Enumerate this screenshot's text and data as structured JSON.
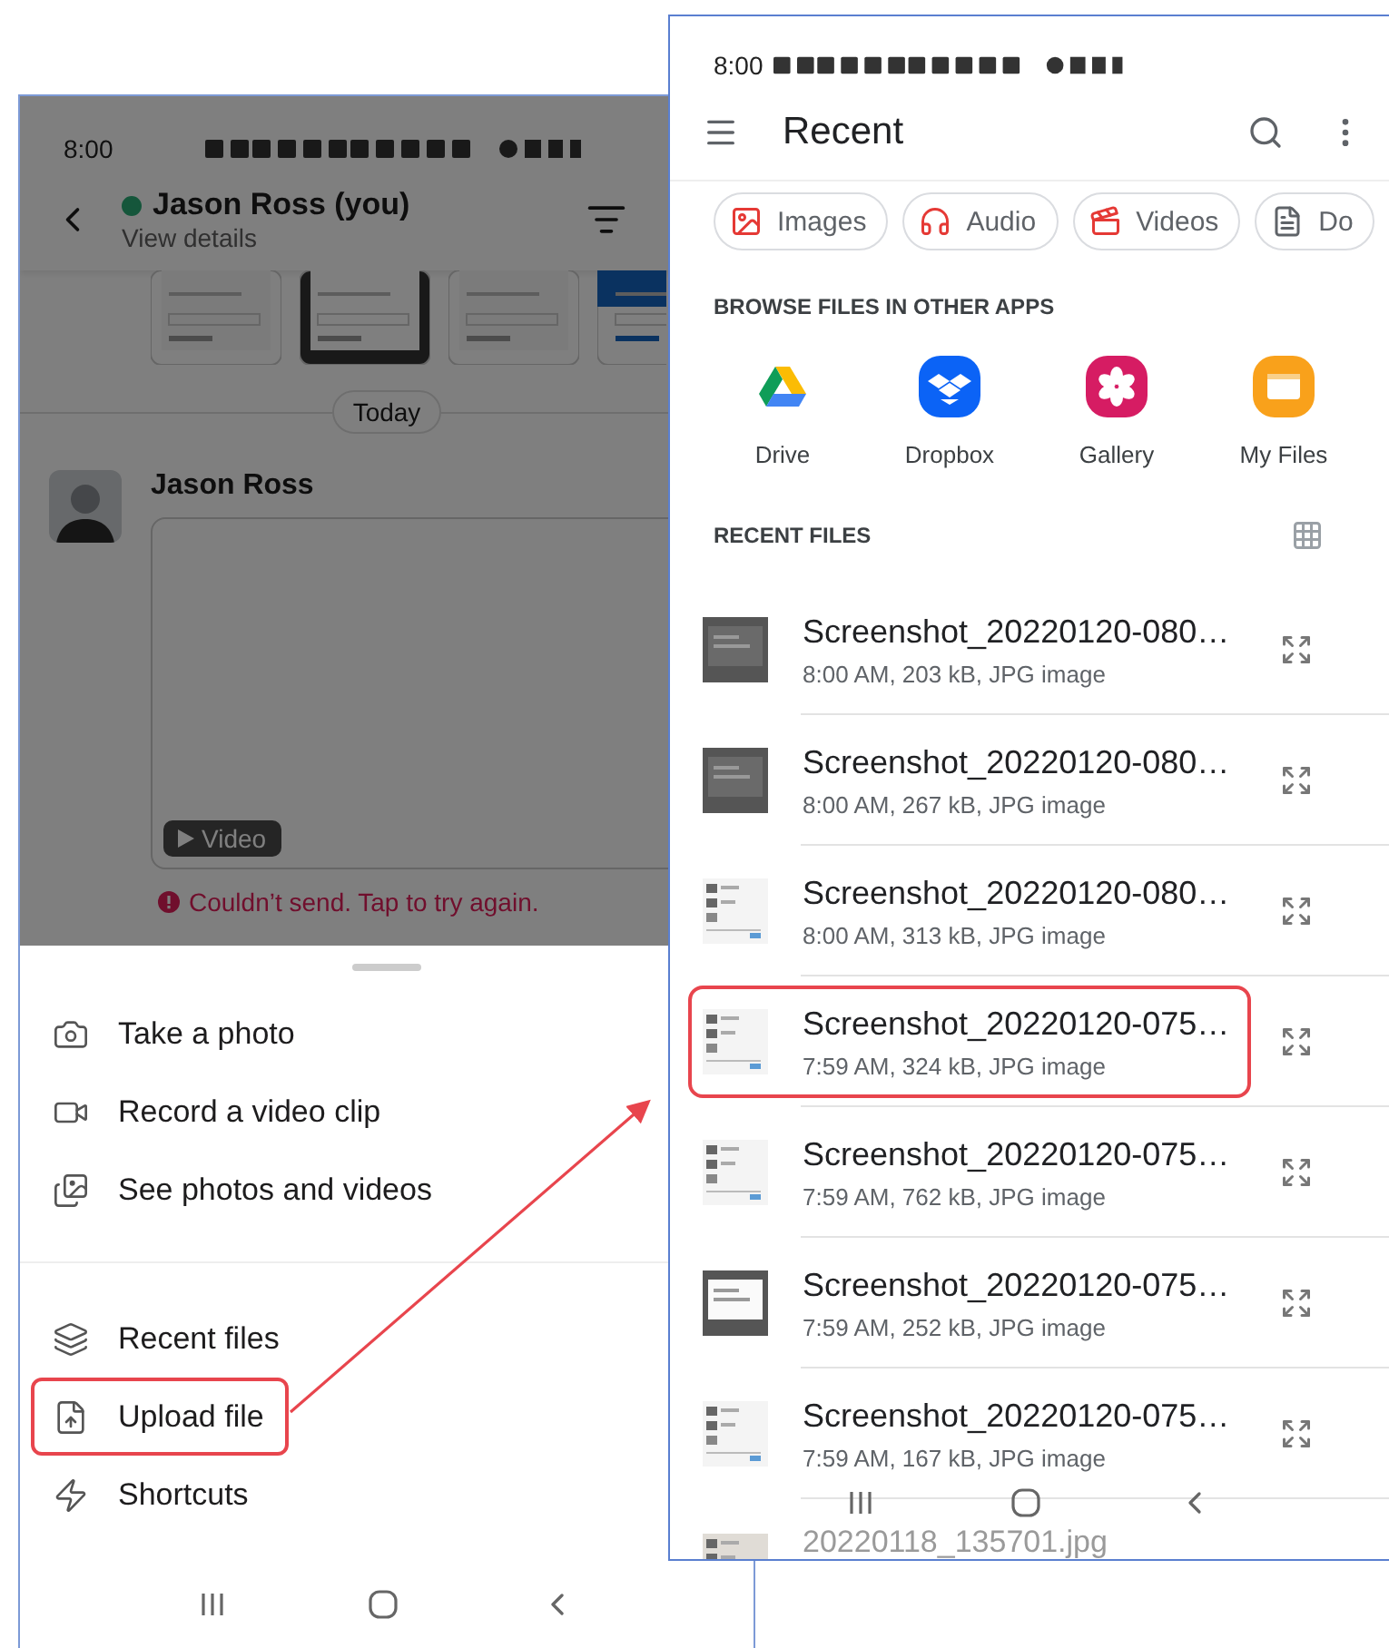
{
  "left_phone": {
    "status_time": "8:00",
    "dimmed": true,
    "chat": {
      "title": "Jason Ross (you)",
      "online": true,
      "subtitle": "View details",
      "day_divider": "Today",
      "message": {
        "sender": "Jason Ross",
        "attachment_label": "Video",
        "error": "Couldn’t send. Tap to try again."
      }
    },
    "sheet": {
      "sections": [
        [
          {
            "kind": "camera",
            "label": "Take a photo",
            "highlighted": false
          },
          {
            "kind": "video",
            "label": "Record a video clip",
            "highlighted": false
          },
          {
            "kind": "gallery",
            "label": "See photos and videos",
            "highlighted": false
          }
        ],
        [
          {
            "kind": "layers",
            "label": "Recent files",
            "highlighted": false
          },
          {
            "kind": "upload",
            "label": "Upload file",
            "highlighted": true
          },
          {
            "kind": "bolt",
            "label": "Shortcuts",
            "highlighted": false
          }
        ]
      ]
    }
  },
  "right_phone": {
    "status_time": "8:00",
    "title": "Recent",
    "chips": [
      {
        "kind": "images",
        "label": "Images"
      },
      {
        "kind": "audio",
        "label": "Audio"
      },
      {
        "kind": "videos",
        "label": "Videos"
      },
      {
        "kind": "docs",
        "label": "Do"
      }
    ],
    "apps_heading": "BROWSE FILES IN OTHER APPS",
    "apps": [
      {
        "kind": "drive",
        "label": "Drive"
      },
      {
        "kind": "dropbox",
        "label": "Dropbox"
      },
      {
        "kind": "gallery",
        "label": "Gallery"
      },
      {
        "kind": "myfiles",
        "label": "My Files"
      }
    ],
    "recent_heading": "RECENT FILES",
    "files": [
      {
        "name": "Screenshot_20220120-080…",
        "details": "8:00 AM, 203 kB, JPG image",
        "highlighted": false
      },
      {
        "name": "Screenshot_20220120-080…",
        "details": "8:00 AM, 267 kB, JPG image",
        "highlighted": false
      },
      {
        "name": "Screenshot_20220120-080…",
        "details": "8:00 AM, 313 kB, JPG image",
        "highlighted": false
      },
      {
        "name": "Screenshot_20220120-075…",
        "details": "7:59 AM, 324 kB, JPG image",
        "highlighted": true
      },
      {
        "name": "Screenshot_20220120-075…",
        "details": "7:59 AM, 762 kB, JPG image",
        "highlighted": false
      },
      {
        "name": "Screenshot_20220120-075…",
        "details": "7:59 AM, 252 kB, JPG image",
        "highlighted": false
      },
      {
        "name": "Screenshot_20220120-075…",
        "details": "7:59 AM, 167 kB, JPG image",
        "highlighted": false
      }
    ],
    "partial_file": "20220118_135701.jpg"
  }
}
